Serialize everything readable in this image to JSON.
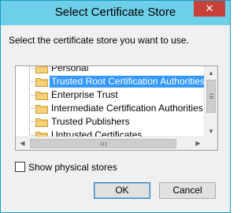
{
  "window": {
    "title": "Select Certificate Store",
    "close_label": "✕"
  },
  "instruction": "Select the certificate store you want to use.",
  "stores": [
    {
      "label": "Personal",
      "selected": false
    },
    {
      "label": "Trusted Root Certification Authorities",
      "selected": true
    },
    {
      "label": "Enterprise Trust",
      "selected": false
    },
    {
      "label": "Intermediate Certification Authorities",
      "selected": false
    },
    {
      "label": "Trusted Publishers",
      "selected": false
    },
    {
      "label": "Untrusted Certificates",
      "selected": false
    }
  ],
  "show_physical": {
    "label": "Show physical stores",
    "checked": false
  },
  "buttons": {
    "ok": "OK",
    "cancel": "Cancel"
  },
  "colors": {
    "titlebar": "#6ecfe8",
    "close_button": "#c7413a",
    "selection": "#3399ff",
    "folder": "#f5d27a"
  }
}
